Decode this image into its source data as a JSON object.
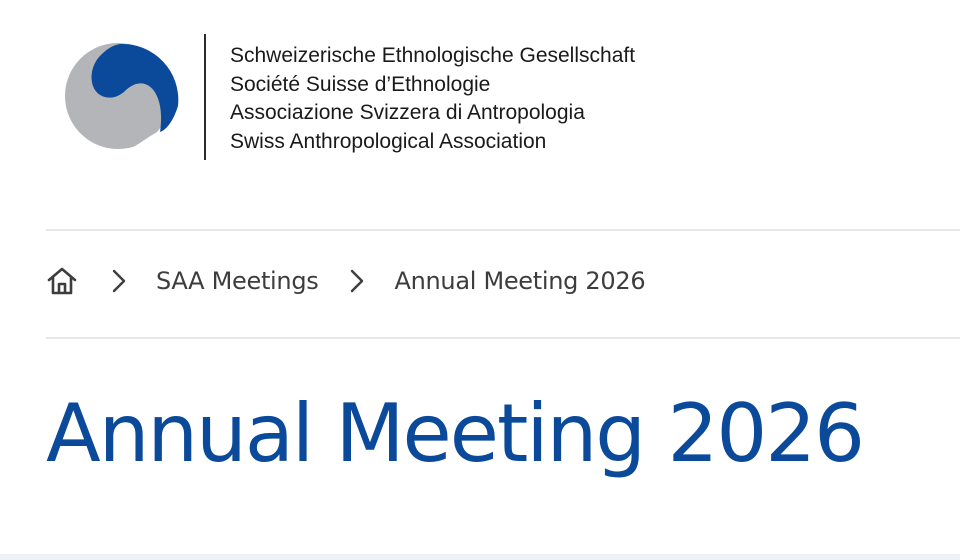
{
  "header": {
    "org_names": [
      "Schweizerische Ethnologische Gesellschaft",
      "Société Suisse d’Ethnologie",
      "Associazione Svizzera di Antropologia",
      "Swiss Anthropological Association"
    ]
  },
  "breadcrumb": {
    "home_icon": "home-icon",
    "separator_icon": "chevron-right-icon",
    "items": [
      {
        "label": "SAA Meetings"
      },
      {
        "label": "Annual Meeting 2026"
      }
    ]
  },
  "page": {
    "title": "Annual Meeting 2026"
  },
  "colors": {
    "brand_blue": "#0b4a9a",
    "logo_gray": "#b3b5b8",
    "text_dark": "#1a1a1a",
    "breadcrumb_text": "#3d3d3d",
    "divider": "#e6e6e6"
  }
}
